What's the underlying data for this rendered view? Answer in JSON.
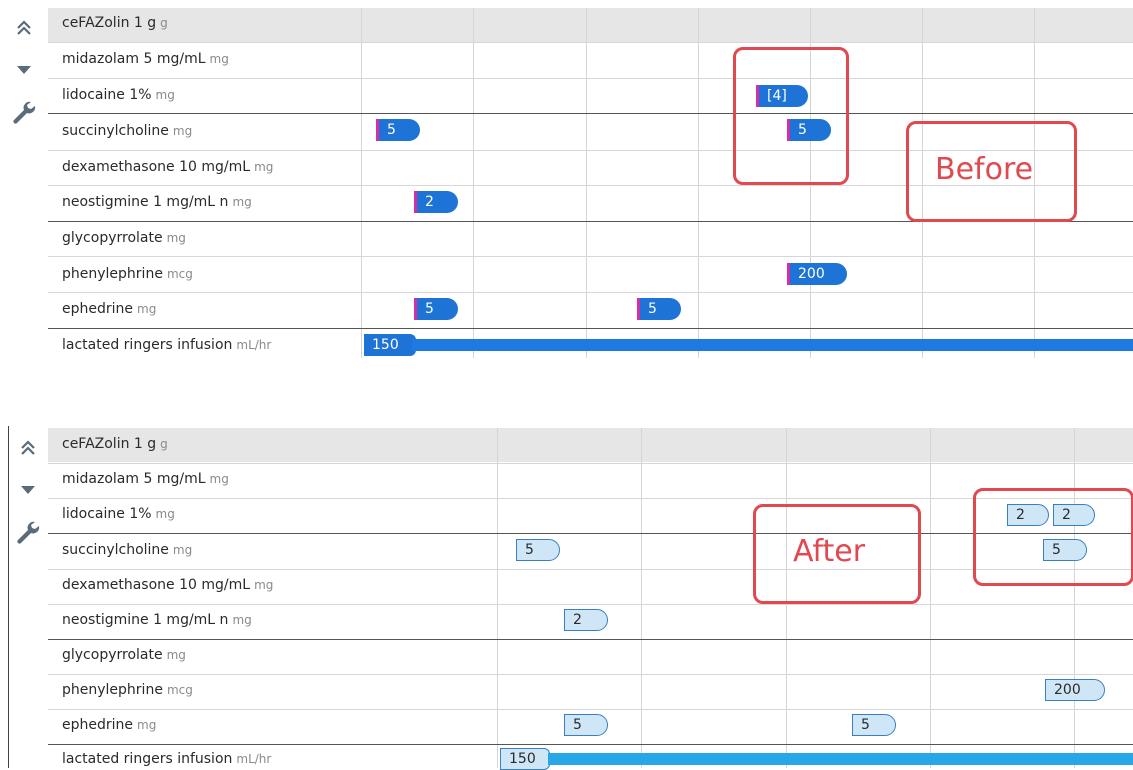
{
  "rows": [
    {
      "name": "ceFAZolin 1 g",
      "unit": "g"
    },
    {
      "name": "midazolam 5 mg/mL",
      "unit": "mg"
    },
    {
      "name": "lidocaine 1%",
      "unit": "mg"
    },
    {
      "name": "succinylcholine",
      "unit": "mg"
    },
    {
      "name": "dexamethasone 10 mg/mL",
      "unit": "mg"
    },
    {
      "name": "neostigmine 1 mg/mL n",
      "unit": "mg"
    },
    {
      "name": "glycopyrrolate",
      "unit": "mg"
    },
    {
      "name": "phenylephrine",
      "unit": "mcg"
    },
    {
      "name": "ephedrine",
      "unit": "mg"
    },
    {
      "name": "lactated ringers infusion",
      "unit": "mL/hr"
    }
  ],
  "before": {
    "label": "Before",
    "doses": {
      "lidocaine": "[4]",
      "succ1": "5",
      "succ2": "5",
      "neo": "2",
      "phenyl": "200",
      "eph1": "5",
      "eph2": "5",
      "lr": "150"
    }
  },
  "after": {
    "label": "After",
    "doses": {
      "lido1": "2",
      "lido2": "2",
      "succ1": "5",
      "succ2": "5",
      "neo": "2",
      "phenyl": "200",
      "eph1": "5",
      "eph2": "5",
      "lr": "150"
    }
  },
  "icons": {
    "collapse": "double-chevron-up-icon",
    "expand": "triangle-down-icon",
    "settings": "wrench-icon"
  },
  "colors": {
    "before_badge": "#1e74d6",
    "after_badge": "#cfe6f7",
    "highlight": "#e0494f"
  }
}
